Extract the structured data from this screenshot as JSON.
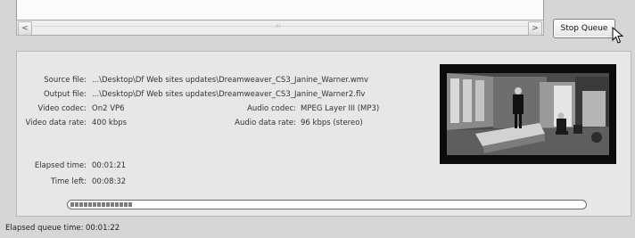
{
  "queue": {
    "stop_label": "Stop Queue",
    "scroll_left": "<",
    "scroll_right": ">"
  },
  "encoding": {
    "source_label": "Source file:",
    "source_value": "...\\Desktop\\Df Web sites updates\\Dreamweaver_CS3_Janine_Warner.wmv",
    "output_label": "Output file:",
    "output_value": "...\\Desktop\\Df Web sites updates\\Dreamweaver_CS3_Janine_Warner2.flv",
    "video_codec_label": "Video codec:",
    "video_codec_value": "On2 VP6",
    "audio_codec_label": "Audio codec:",
    "audio_codec_value": "MPEG Layer III (MP3)",
    "video_rate_label": "Video data rate:",
    "video_rate_value": "400 kbps",
    "audio_rate_label": "Audio data rate:",
    "audio_rate_value": "96 kbps (stereo)",
    "elapsed_label": "Elapsed time:",
    "elapsed_value": "00:01:21",
    "time_left_label": "Time left:",
    "time_left_value": "00:08:32",
    "progress_fraction": 0.12
  },
  "footer": {
    "queue_time_label": "Elapsed queue time:",
    "queue_time_value": "00:01:22"
  },
  "colors": {
    "panel_bg": "#e7e7e7",
    "window_bg": "#d6d6d6"
  },
  "icons": [
    "cursor-pointer-icon"
  ]
}
